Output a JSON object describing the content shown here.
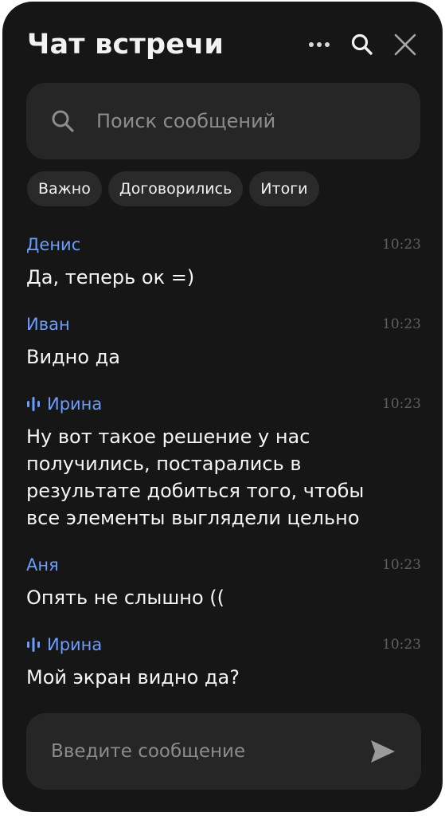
{
  "header": {
    "title": "Чат встречи",
    "icons": [
      "more-icon",
      "search-icon",
      "close-icon"
    ]
  },
  "search": {
    "placeholder": "Поиск сообщений",
    "value": ""
  },
  "filters": [
    {
      "label": "Важно"
    },
    {
      "label": "Договорились"
    },
    {
      "label": "Итоги"
    }
  ],
  "messages": [
    {
      "author": "Денис",
      "time": "10:23",
      "text": "Да, теперь ок =)",
      "speaking": false
    },
    {
      "author": "Иван",
      "time": "10:23",
      "text": "Видно да",
      "speaking": false
    },
    {
      "author": "Ирина",
      "time": "10:23",
      "text": "Ну вот такое решение у нас получились, постарались в результате добиться того, чтобы все элементы выглядели цельно",
      "speaking": true
    },
    {
      "author": "Аня",
      "time": "10:23",
      "text": "Опять не слышно ((",
      "speaking": false
    },
    {
      "author": "Ирина",
      "time": "10:23",
      "text": "Мой экран видно да?",
      "speaking": true
    }
  ],
  "composer": {
    "placeholder": "Введите сообщение",
    "value": ""
  },
  "colors": {
    "background": "#161616",
    "field": "#262626",
    "chip": "#2a2a2a",
    "author": "#6b9cff",
    "time": "#5f5f5f"
  }
}
